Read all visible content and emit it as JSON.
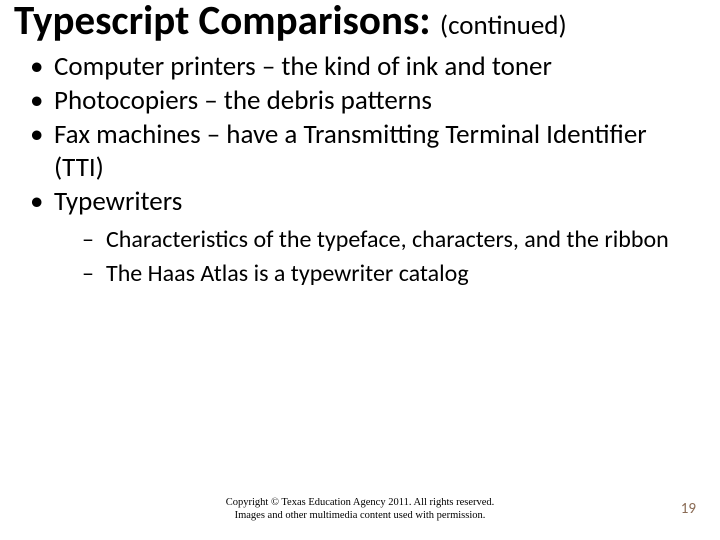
{
  "title": {
    "main": "Typescript Comparisons: ",
    "sub": "(continued)"
  },
  "bullets": [
    {
      "text": "Computer printers – the kind of ink and toner"
    },
    {
      "text": "Photocopiers – the debris patterns"
    },
    {
      "text": "Fax machines – have a Transmitting Terminal Identifier (TTI)"
    },
    {
      "text": "Typewriters",
      "children": [
        {
          "text": "Characteristics of the typeface, characters, and the ribbon"
        },
        {
          "text": "The Haas Atlas is a typewriter catalog"
        }
      ]
    }
  ],
  "footer": {
    "line1": "Copyright © Texas Education Agency 2011. All rights reserved.",
    "line2": "Images and other multimedia content used with permission."
  },
  "page_number": "19"
}
